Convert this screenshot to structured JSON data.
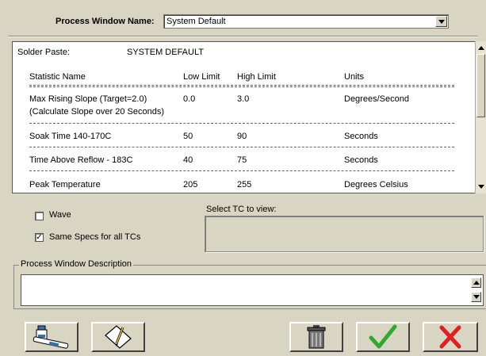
{
  "process_window": {
    "label": "Process Window Name:",
    "selected": "System Default"
  },
  "panel": {
    "solder_label": "Solder Paste:",
    "solder_value": "SYSTEM DEFAULT",
    "headers": {
      "name": "Statistic Name",
      "low": "Low Limit",
      "high": "High Limit",
      "units": "Units"
    },
    "rows": [
      {
        "name": "Max Rising Slope (Target=2.0)",
        "name2": "(Calculate Slope over 20 Seconds)",
        "low": "0.0",
        "high": "3.0",
        "units": "Degrees/Second"
      },
      {
        "name": "Soak Time 140-170C",
        "low": "50",
        "high": "90",
        "units": "Seconds"
      },
      {
        "name": "Time Above Reflow - 183C",
        "low": "40",
        "high": "75",
        "units": "Seconds"
      },
      {
        "name": "Peak Temperature",
        "low": "205",
        "high": "255",
        "units": "Degrees Celsius"
      }
    ]
  },
  "options": {
    "wave_label": "Wave",
    "wave_checked": false,
    "same_specs_label": "Same Specs for all TCs",
    "same_specs_checked": true,
    "select_tc_label": "Select TC to view:"
  },
  "description": {
    "legend": "Process Window Description",
    "value": ""
  },
  "icons": {
    "solder": "solder-paste-icon",
    "edit": "edit-note-icon",
    "delete": "trash-icon",
    "ok": "checkmark-icon",
    "cancel": "x-icon"
  },
  "colors": {
    "background": "#d8d5c3",
    "ok_green": "#2fa82f",
    "cancel_red": "#e02020"
  }
}
